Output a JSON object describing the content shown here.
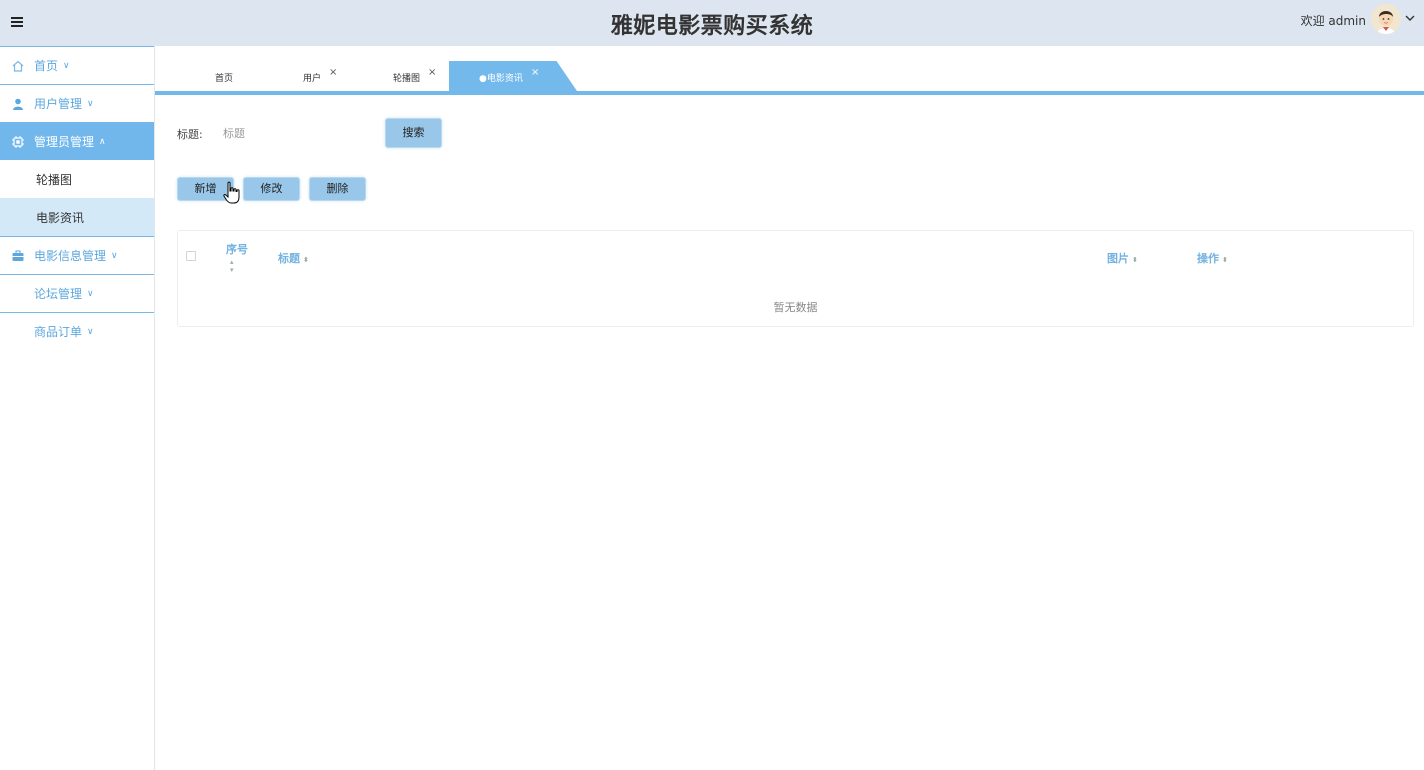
{
  "header": {
    "title": "雅妮电影票购买系统",
    "welcome": "欢迎 admin"
  },
  "sidebar": {
    "items": [
      {
        "label": "首页",
        "icon": "home-icon"
      },
      {
        "label": "用户管理",
        "icon": "user-icon"
      },
      {
        "label": "管理员管理",
        "icon": "chip-icon",
        "expanded": true,
        "children": [
          {
            "label": "轮播图"
          },
          {
            "label": "电影资讯",
            "selected": true
          }
        ]
      },
      {
        "label": "电影信息管理",
        "icon": "briefcase-icon"
      },
      {
        "label": "论坛管理"
      },
      {
        "label": "商品订单"
      }
    ]
  },
  "tabs": [
    {
      "label": "首页"
    },
    {
      "label": "用户",
      "close": "×"
    },
    {
      "label": "轮播图",
      "close": "×"
    },
    {
      "label": "●电影资讯",
      "close": "×",
      "active": true
    }
  ],
  "search": {
    "label": "标题:",
    "placeholder": "标题",
    "button": "搜索"
  },
  "actions": {
    "add": "新增",
    "edit": "修改",
    "delete": "删除"
  },
  "table": {
    "columns": [
      "序号",
      "标题",
      "图片",
      "操作"
    ],
    "empty_text": "暂无数据"
  },
  "colors": {
    "accent": "#74b9ec",
    "header_bg": "#dde6f0",
    "button_bg": "#99c7ea",
    "link": "#5ca7dd"
  }
}
